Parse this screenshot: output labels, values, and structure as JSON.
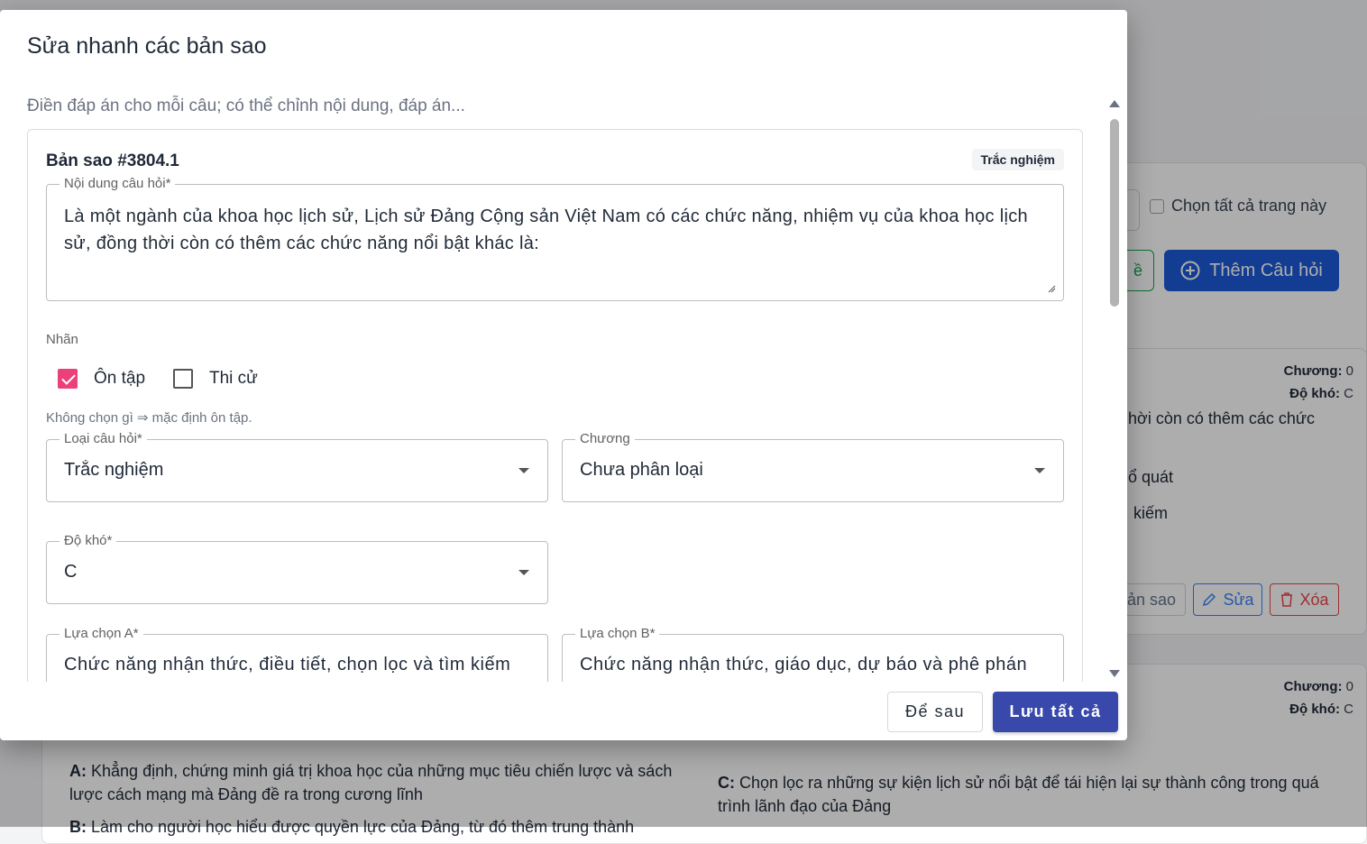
{
  "background": {
    "select_all_label": "Chọn tất cả trang này",
    "import_button_tail": "ề",
    "add_question_button": "Thêm Câu hỏi",
    "cards": [
      {
        "chapter_label": "Chương:",
        "chapter_value": "0",
        "difficulty_label": "Độ khó:",
        "difficulty_value": "C",
        "snippet_1": "hời còn có thêm các chức",
        "snippet_2": "ổ quát",
        "snippet_3": "kiếm",
        "copy_button_tail": "ản sao",
        "edit_button": "Sửa",
        "delete_button": "Xóa"
      },
      {
        "chapter_label": "Chương:",
        "chapter_value": "0",
        "difficulty_label": "Độ khó:",
        "difficulty_value": "C",
        "option_a_prefix": "A:",
        "option_a_text": "Khẳng định, chứng minh giá trị khoa học của những mục tiêu chiến lược và sách lược cách mạng mà Đảng đề ra trong cương lĩnh",
        "option_b_prefix": "B:",
        "option_b_text": "Làm cho người học hiểu được quyền lực của Đảng, từ đó thêm trung thành",
        "option_c_prefix": "C:",
        "option_c_text": "Chọn lọc ra những sự kiện lịch sử nổi bật để tái hiện lại sự thành công trong quá trình lãnh đạo của Đảng"
      }
    ]
  },
  "modal": {
    "title": "Sửa nhanh các bản sao",
    "description": "Điền đáp án cho mỗi câu; có thể chỉnh nội dung, đáp án...",
    "copy": {
      "title": "Bản sao #3804.1",
      "type_badge": "Trắc nghiệm",
      "content_label": "Nội dung câu hỏi*",
      "content_value": "Là một ngành của khoa học lịch sử, Lịch sử Đảng Cộng sản Việt Nam có các chức năng, nhiệm vụ của khoa học lịch sử, đồng thời còn có thêm các chức năng nổi bật khác là:",
      "labels_heading": "Nhãn",
      "label_review": "Ôn tập",
      "label_review_checked": true,
      "label_exam": "Thi cử",
      "label_exam_checked": false,
      "labels_hint": "Không chọn gì ⇒ mặc định ôn tập.",
      "type_label": "Loại câu hỏi*",
      "type_value": "Trắc nghiệm",
      "chapter_label": "Chương",
      "chapter_value": "Chưa phân loại",
      "difficulty_label": "Độ khó*",
      "difficulty_value": "C",
      "option_a_label": "Lựa chọn A*",
      "option_a_value": "Chức năng nhận thức, điều tiết, chọn lọc và tìm kiếm",
      "option_b_label": "Lựa chọn B*",
      "option_b_value": "Chức năng nhận thức, giáo dục, dự báo và phê phán"
    },
    "footer": {
      "later_button": "Để sau",
      "save_all_button": "Lưu tất cả"
    }
  },
  "colors": {
    "primary": "#3949ab",
    "checkbox_checked": "#ec407a",
    "add_button": "#1d5bd8"
  }
}
